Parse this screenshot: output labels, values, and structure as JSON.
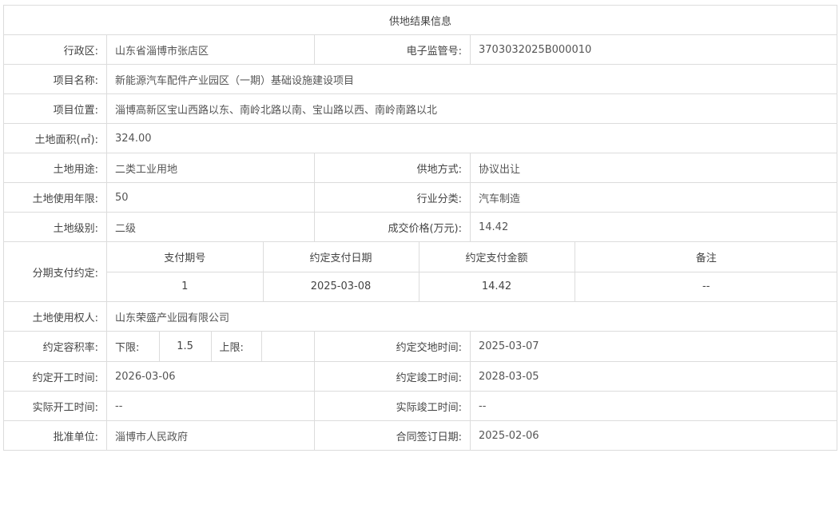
{
  "title": "供地结果信息",
  "fields": {
    "district_label": "行政区:",
    "district": "山东省淄博市张店区",
    "supervision_label": "电子监管号:",
    "supervision_no": "3703032025B000010",
    "project_name_label": "项目名称:",
    "project_name": "新能源汽车配件产业园区（一期）基础设施建设项目",
    "project_location_label": "项目位置:",
    "project_location": "淄博高新区宝山西路以东、南岭北路以南、宝山路以西、南岭南路以北",
    "area_label": "土地面积(㎡):",
    "area": "324.00",
    "land_use_label": "土地用途:",
    "land_use": "二类工业用地",
    "supply_method_label": "供地方式:",
    "supply_method": "协议出让",
    "term_label": "土地使用年限:",
    "term": "50",
    "industry_label": "行业分类:",
    "industry": "汽车制造",
    "grade_label": "土地级别:",
    "grade": "二级",
    "price_label": "成交价格(万元):",
    "price": "14.42",
    "installment_label": "分期支付约定:",
    "owner_label": "土地使用权人:",
    "owner": "山东荣盛产业园有限公司",
    "far_label": "约定容积率:",
    "far_lower_label": "下限:",
    "far_lower": "1.5",
    "far_upper_label": "上限:",
    "far_upper": "",
    "delivery_label": "约定交地时间:",
    "delivery_date": "2025-03-07",
    "start_label": "约定开工时间:",
    "start_date": "2026-03-06",
    "completion_label": "约定竣工时间:",
    "completion_date": "2028-03-05",
    "actual_start_label": "实际开工时间:",
    "actual_start": "--",
    "actual_completion_label": "实际竣工时间:",
    "actual_completion": "--",
    "approver_label": "批准单位:",
    "approver": "淄博市人民政府",
    "contract_date_label": "合同签订日期:",
    "contract_date": "2025-02-06"
  },
  "installments": {
    "headers": [
      "支付期号",
      "约定支付日期",
      "约定支付金额",
      "备注"
    ],
    "rows": [
      [
        "1",
        "2025-03-08",
        "14.42",
        "--"
      ]
    ]
  }
}
